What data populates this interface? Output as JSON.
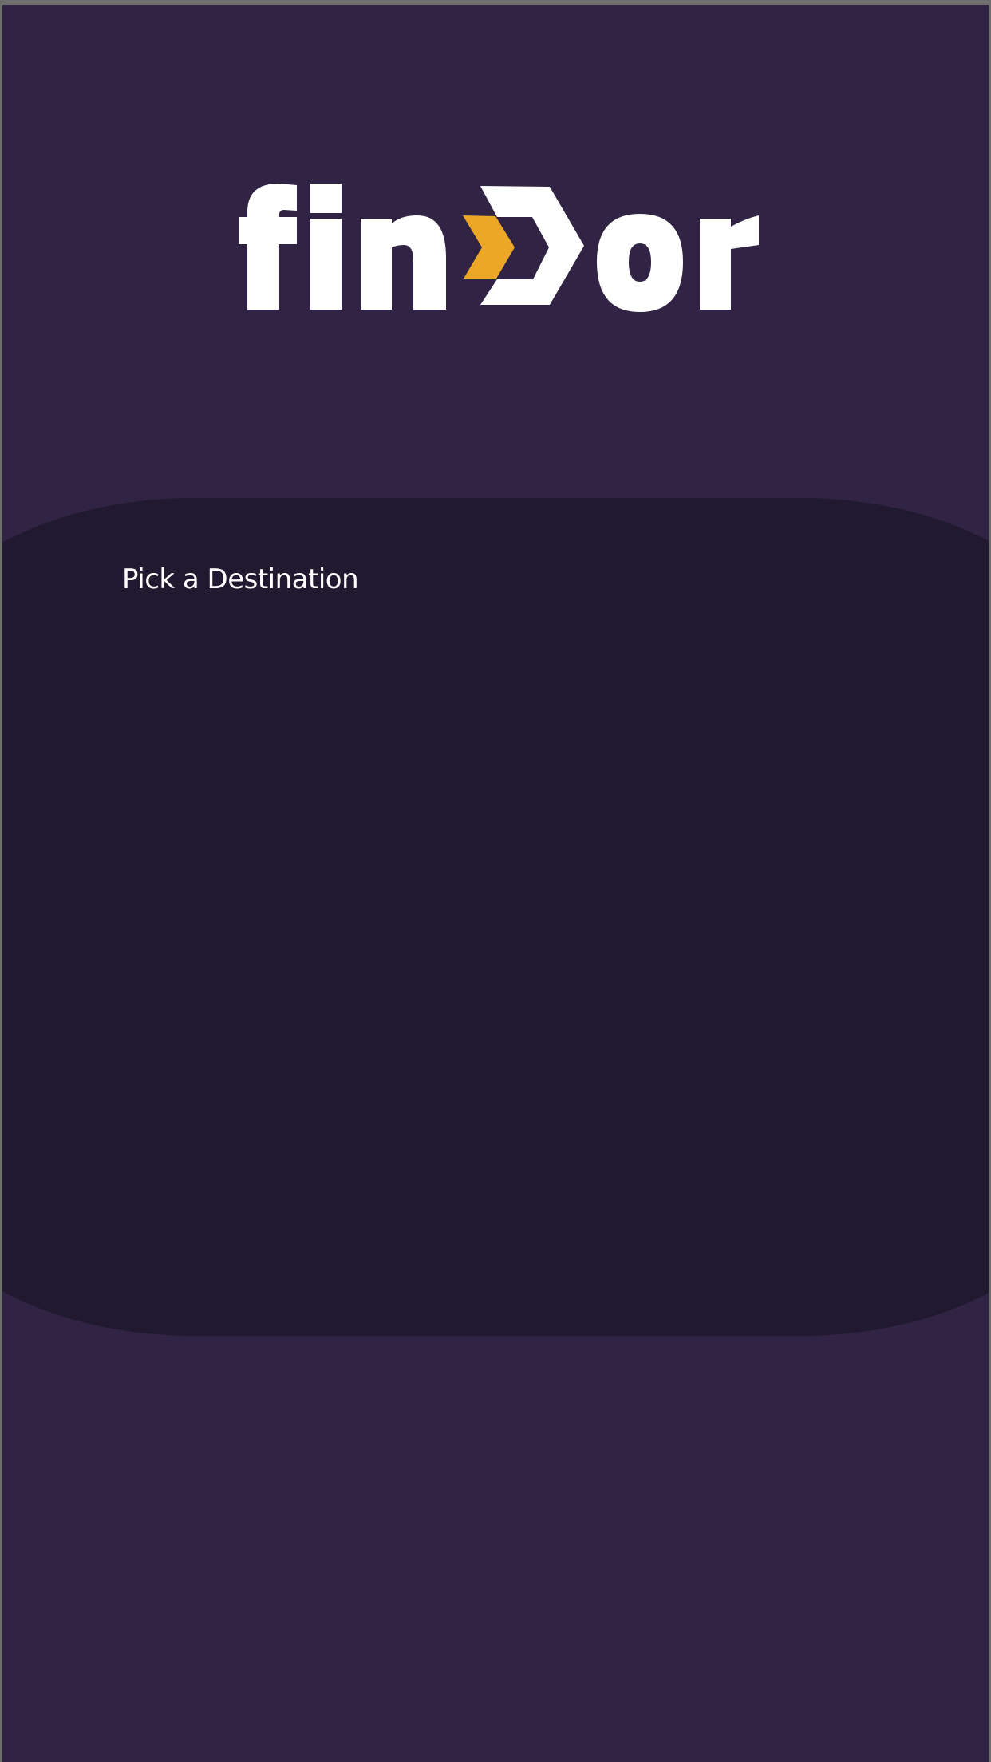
{
  "app": {
    "logo": {
      "wordmark": "findor",
      "colors": {
        "letters": "#ffffff",
        "accent": "#eca726"
      }
    }
  },
  "destination_panel": {
    "title": "Pick a Destination"
  },
  "colors": {
    "background": "#312343",
    "panel": "#20192f",
    "text": "#ffffff"
  }
}
